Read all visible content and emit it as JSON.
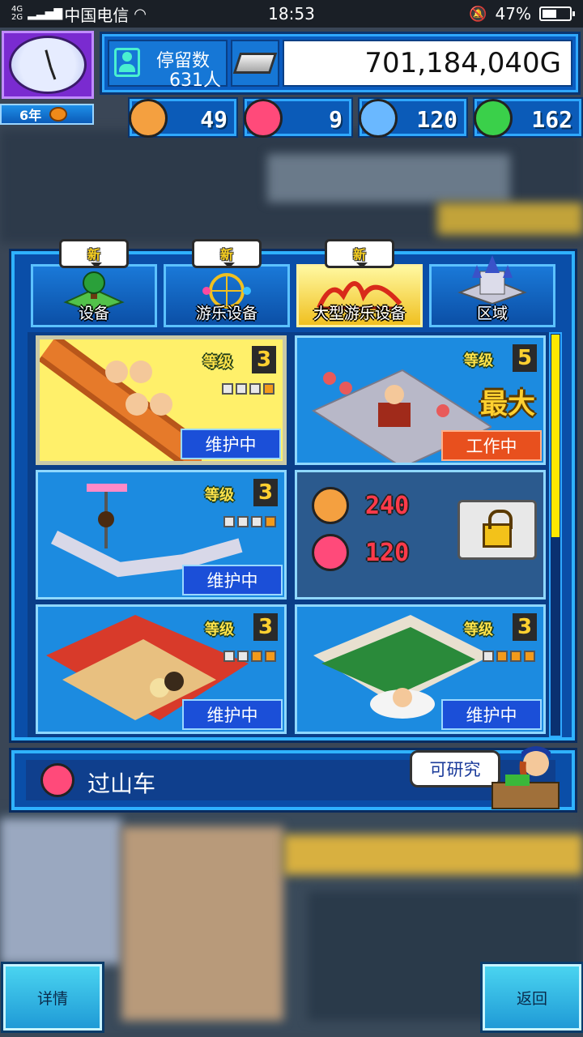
{
  "status_bar": {
    "network": "4G\n2G",
    "carrier": "中国电信",
    "time": "18:53",
    "battery": "47%"
  },
  "hud": {
    "year": "6年",
    "visitors_label": "停留数",
    "visitors_count": "631人",
    "money": "701,184,040G",
    "resources": [
      {
        "icon": "orange-smile-icon",
        "value": "49",
        "color": "#f4a040"
      },
      {
        "icon": "red-flame-icon",
        "value": "9",
        "color": "#ff4a7a"
      },
      {
        "icon": "blue-drop-icon",
        "value": "120",
        "color": "#6ab8ff"
      },
      {
        "icon": "green-clover-icon",
        "value": "162",
        "color": "#3ad04a"
      }
    ]
  },
  "tabs": [
    {
      "label": "设备",
      "new": "新",
      "active": false
    },
    {
      "label": "游乐设备",
      "new": "新",
      "active": false
    },
    {
      "label": "大型游乐设备",
      "new": "新",
      "active": true
    },
    {
      "label": "区域",
      "new": "",
      "active": false
    }
  ],
  "cards": [
    {
      "level_label": "等级",
      "level": "3",
      "pips": [
        false,
        false,
        false,
        true
      ],
      "status": "维护中",
      "status_type": "maintain",
      "selected": true
    },
    {
      "level_label": "等级",
      "level": "5",
      "max": "最大",
      "status": "工作中",
      "status_type": "working",
      "selected": false
    },
    {
      "level_label": "等级",
      "level": "3",
      "pips": [
        false,
        false,
        false,
        true
      ],
      "status": "维护中",
      "status_type": "maintain",
      "selected": false
    },
    {
      "locked": true,
      "req": [
        {
          "icon": "orange-smile-icon",
          "value": "240"
        },
        {
          "icon": "red-flame-icon",
          "value": "120"
        }
      ]
    },
    {
      "level_label": "等级",
      "level": "3",
      "pips": [
        false,
        false,
        true,
        true
      ],
      "status": "维护中",
      "status_type": "maintain",
      "selected": false
    },
    {
      "level_label": "等级",
      "level": "3",
      "pips": [
        false,
        true,
        true,
        true
      ],
      "status": "维护中",
      "status_type": "maintain",
      "selected": false
    }
  ],
  "info": {
    "selected_name": "过山车",
    "research_bubble": "可研究"
  },
  "buttons": {
    "details": "详情",
    "back": "返回"
  }
}
